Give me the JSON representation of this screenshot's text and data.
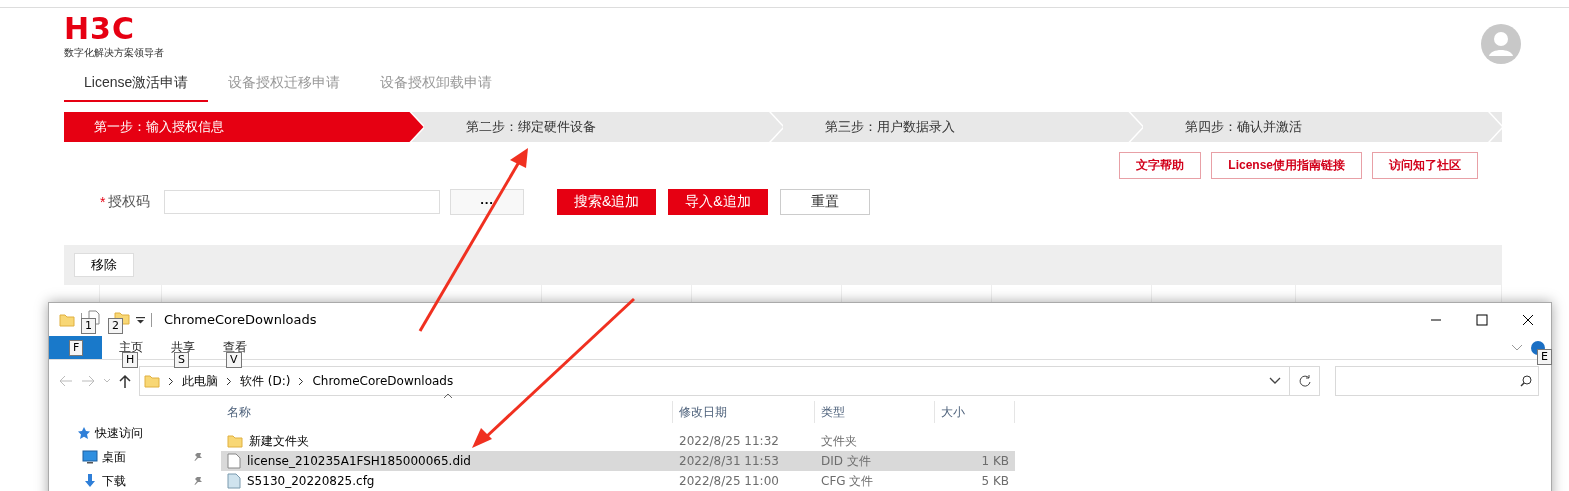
{
  "logo": {
    "mark": "H3C",
    "slogan": "数字化解决方案领导者"
  },
  "tabs": [
    {
      "label": "License激活申请",
      "selected": true
    },
    {
      "label": "设备授权迁移申请",
      "selected": false
    },
    {
      "label": "设备授权卸载申请",
      "selected": false
    }
  ],
  "steps": [
    {
      "label": "第一步：输入授权信息",
      "selected": true
    },
    {
      "label": "第二步：绑定硬件设备",
      "selected": false
    },
    {
      "label": "第三步：用户数据录入",
      "selected": false
    },
    {
      "label": "第四步：确认并激活",
      "selected": false
    }
  ],
  "help_links": [
    "文字帮助",
    "License使用指南链接",
    "访问知了社区"
  ],
  "form": {
    "label": "授权码",
    "required": "*",
    "more": "···",
    "buttons": [
      {
        "label": "搜索&追加",
        "kind": "primary"
      },
      {
        "label": "导入&追加",
        "kind": "primary"
      },
      {
        "label": "重置",
        "kind": "default"
      }
    ]
  },
  "toolbar": {
    "buttons": [
      "移除"
    ]
  },
  "explorer": {
    "title": "ChromeCoreDownloads",
    "quick_access_tips": [
      "1",
      "2"
    ],
    "ribbon_tabs": [
      {
        "key_tip": "F",
        "selected": true
      },
      {
        "label": "主页",
        "key_tip": "H",
        "selected": false
      },
      {
        "label": "共享",
        "key_tip": "S",
        "selected": false
      },
      {
        "label": "查看",
        "key_tip": "V",
        "selected": false
      }
    ],
    "help_key_tip": "E",
    "breadcrumbs": [
      "此电脑",
      "软件 (D:)",
      "ChromeCoreDownloads"
    ],
    "nav": [
      {
        "label": "快速访问",
        "kind": "star",
        "pinned": false
      },
      {
        "label": "桌面",
        "kind": "desktop",
        "pinned": true
      },
      {
        "label": "下载",
        "kind": "download",
        "pinned": true
      }
    ],
    "columns": [
      "名称",
      "修改日期",
      "类型",
      "大小"
    ],
    "files": [
      {
        "name": "新建文件夹",
        "date": "2022/8/25 11:32",
        "type": "文件夹",
        "kind": "folder",
        "selected": false
      },
      {
        "name": "license_210235A1FSH185000065.did",
        "date": "2022/8/31 11:53",
        "type": "DID 文件",
        "size": "1 KB",
        "kind": "file",
        "selected": true
      },
      {
        "name": "S5130_20220825.cfg",
        "date": "2022/8/25 11:00",
        "type": "CFG 文件",
        "size": "5 KB",
        "kind": "config",
        "selected": false
      }
    ]
  }
}
